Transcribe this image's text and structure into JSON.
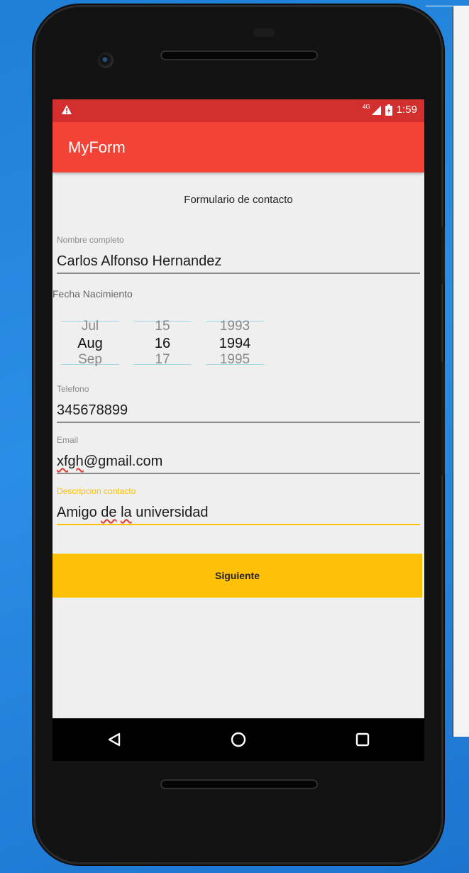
{
  "status_bar": {
    "network_label": "4G",
    "time": "1:59"
  },
  "app_bar": {
    "title": "MyForm"
  },
  "form": {
    "title": "Formulario de contacto",
    "name": {
      "label": "Nombre completo",
      "value": "Carlos Alfonso Hernandez"
    },
    "birth_date": {
      "label": "Fecha Nacimiento",
      "month": {
        "prev": "Jul",
        "selected": "Aug",
        "next": "Sep"
      },
      "day": {
        "prev": "15",
        "selected": "16",
        "next": "17"
      },
      "year": {
        "prev": "1993",
        "selected": "1994",
        "next": "1995"
      }
    },
    "phone": {
      "label": "Telefono",
      "value": "345678899"
    },
    "email": {
      "label": "Email",
      "value_misspelled": "xfgh",
      "value_rest": "@gmail.com"
    },
    "description": {
      "label": "Descripcion contacto",
      "value_part1": "Amigo ",
      "value_misspelled1": "de",
      "value_part2": " ",
      "value_misspelled2": "la",
      "value_part3": " universidad"
    },
    "submit_label": "Siguiente"
  },
  "colors": {
    "status_bar": "#d32f2f",
    "app_bar": "#f44336",
    "accent": "#ffc107"
  },
  "icons": [
    "warning-icon",
    "signal-icon",
    "battery-icon",
    "back-icon",
    "home-icon",
    "recents-icon"
  ]
}
